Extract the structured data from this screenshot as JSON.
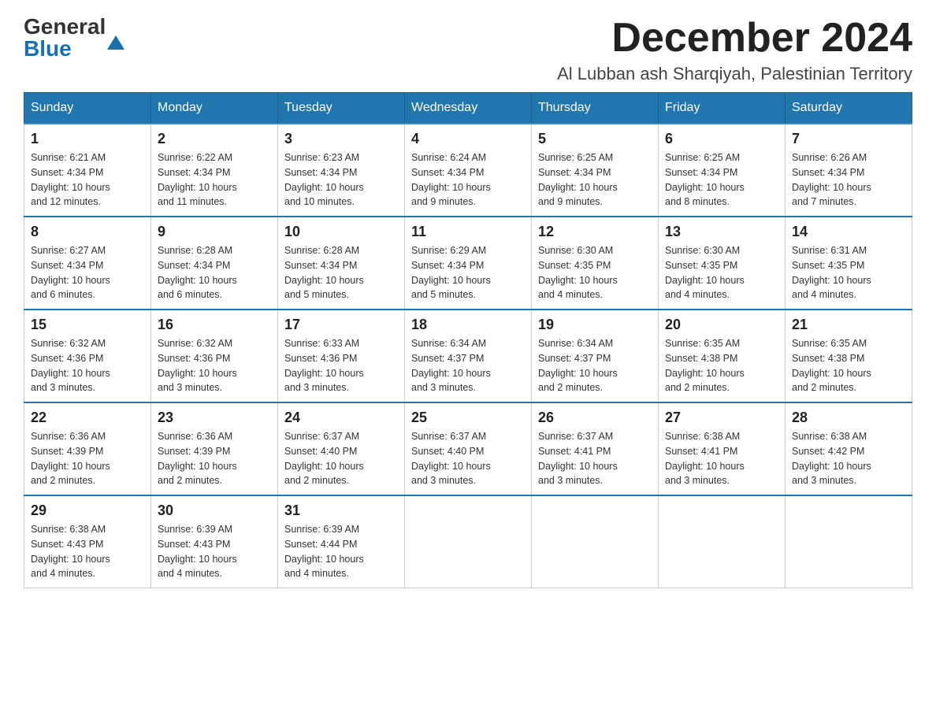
{
  "header": {
    "logo_general": "General",
    "logo_blue": "Blue",
    "month_title": "December 2024",
    "location": "Al Lubban ash Sharqiyah, Palestinian Territory"
  },
  "days_of_week": [
    "Sunday",
    "Monday",
    "Tuesday",
    "Wednesday",
    "Thursday",
    "Friday",
    "Saturday"
  ],
  "weeks": [
    [
      {
        "day": "1",
        "sunrise": "6:21 AM",
        "sunset": "4:34 PM",
        "daylight": "10 hours and 12 minutes."
      },
      {
        "day": "2",
        "sunrise": "6:22 AM",
        "sunset": "4:34 PM",
        "daylight": "10 hours and 11 minutes."
      },
      {
        "day": "3",
        "sunrise": "6:23 AM",
        "sunset": "4:34 PM",
        "daylight": "10 hours and 10 minutes."
      },
      {
        "day": "4",
        "sunrise": "6:24 AM",
        "sunset": "4:34 PM",
        "daylight": "10 hours and 9 minutes."
      },
      {
        "day": "5",
        "sunrise": "6:25 AM",
        "sunset": "4:34 PM",
        "daylight": "10 hours and 9 minutes."
      },
      {
        "day": "6",
        "sunrise": "6:25 AM",
        "sunset": "4:34 PM",
        "daylight": "10 hours and 8 minutes."
      },
      {
        "day": "7",
        "sunrise": "6:26 AM",
        "sunset": "4:34 PM",
        "daylight": "10 hours and 7 minutes."
      }
    ],
    [
      {
        "day": "8",
        "sunrise": "6:27 AM",
        "sunset": "4:34 PM",
        "daylight": "10 hours and 6 minutes."
      },
      {
        "day": "9",
        "sunrise": "6:28 AM",
        "sunset": "4:34 PM",
        "daylight": "10 hours and 6 minutes."
      },
      {
        "day": "10",
        "sunrise": "6:28 AM",
        "sunset": "4:34 PM",
        "daylight": "10 hours and 5 minutes."
      },
      {
        "day": "11",
        "sunrise": "6:29 AM",
        "sunset": "4:34 PM",
        "daylight": "10 hours and 5 minutes."
      },
      {
        "day": "12",
        "sunrise": "6:30 AM",
        "sunset": "4:35 PM",
        "daylight": "10 hours and 4 minutes."
      },
      {
        "day": "13",
        "sunrise": "6:30 AM",
        "sunset": "4:35 PM",
        "daylight": "10 hours and 4 minutes."
      },
      {
        "day": "14",
        "sunrise": "6:31 AM",
        "sunset": "4:35 PM",
        "daylight": "10 hours and 4 minutes."
      }
    ],
    [
      {
        "day": "15",
        "sunrise": "6:32 AM",
        "sunset": "4:36 PM",
        "daylight": "10 hours and 3 minutes."
      },
      {
        "day": "16",
        "sunrise": "6:32 AM",
        "sunset": "4:36 PM",
        "daylight": "10 hours and 3 minutes."
      },
      {
        "day": "17",
        "sunrise": "6:33 AM",
        "sunset": "4:36 PM",
        "daylight": "10 hours and 3 minutes."
      },
      {
        "day": "18",
        "sunrise": "6:34 AM",
        "sunset": "4:37 PM",
        "daylight": "10 hours and 3 minutes."
      },
      {
        "day": "19",
        "sunrise": "6:34 AM",
        "sunset": "4:37 PM",
        "daylight": "10 hours and 2 minutes."
      },
      {
        "day": "20",
        "sunrise": "6:35 AM",
        "sunset": "4:38 PM",
        "daylight": "10 hours and 2 minutes."
      },
      {
        "day": "21",
        "sunrise": "6:35 AM",
        "sunset": "4:38 PM",
        "daylight": "10 hours and 2 minutes."
      }
    ],
    [
      {
        "day": "22",
        "sunrise": "6:36 AM",
        "sunset": "4:39 PM",
        "daylight": "10 hours and 2 minutes."
      },
      {
        "day": "23",
        "sunrise": "6:36 AM",
        "sunset": "4:39 PM",
        "daylight": "10 hours and 2 minutes."
      },
      {
        "day": "24",
        "sunrise": "6:37 AM",
        "sunset": "4:40 PM",
        "daylight": "10 hours and 2 minutes."
      },
      {
        "day": "25",
        "sunrise": "6:37 AM",
        "sunset": "4:40 PM",
        "daylight": "10 hours and 3 minutes."
      },
      {
        "day": "26",
        "sunrise": "6:37 AM",
        "sunset": "4:41 PM",
        "daylight": "10 hours and 3 minutes."
      },
      {
        "day": "27",
        "sunrise": "6:38 AM",
        "sunset": "4:41 PM",
        "daylight": "10 hours and 3 minutes."
      },
      {
        "day": "28",
        "sunrise": "6:38 AM",
        "sunset": "4:42 PM",
        "daylight": "10 hours and 3 minutes."
      }
    ],
    [
      {
        "day": "29",
        "sunrise": "6:38 AM",
        "sunset": "4:43 PM",
        "daylight": "10 hours and 4 minutes."
      },
      {
        "day": "30",
        "sunrise": "6:39 AM",
        "sunset": "4:43 PM",
        "daylight": "10 hours and 4 minutes."
      },
      {
        "day": "31",
        "sunrise": "6:39 AM",
        "sunset": "4:44 PM",
        "daylight": "10 hours and 4 minutes."
      },
      null,
      null,
      null,
      null
    ]
  ],
  "labels": {
    "sunrise": "Sunrise:",
    "sunset": "Sunset:",
    "daylight": "Daylight:"
  }
}
